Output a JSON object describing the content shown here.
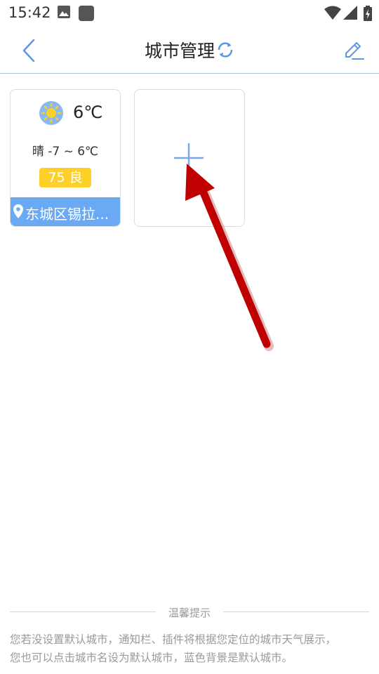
{
  "status_bar": {
    "time": "15:42"
  },
  "header": {
    "title": "城市管理"
  },
  "city_card": {
    "temperature": "6℃",
    "range": "晴 -7 ~ 6℃",
    "aqi": "75 良",
    "city_name": "东城区锡拉..."
  },
  "tips": {
    "title": "温馨提示",
    "line1": "您若没设置默认城市，通知栏、插件将根据您定位的城市天气展示，",
    "line2": "您也可以点击城市名设为默认城市，蓝色背景是默认城市。"
  },
  "colors": {
    "accent_blue": "#6aaaf5",
    "aqi_yellow": "#fdd02a",
    "annotation_red": "#c00000"
  }
}
